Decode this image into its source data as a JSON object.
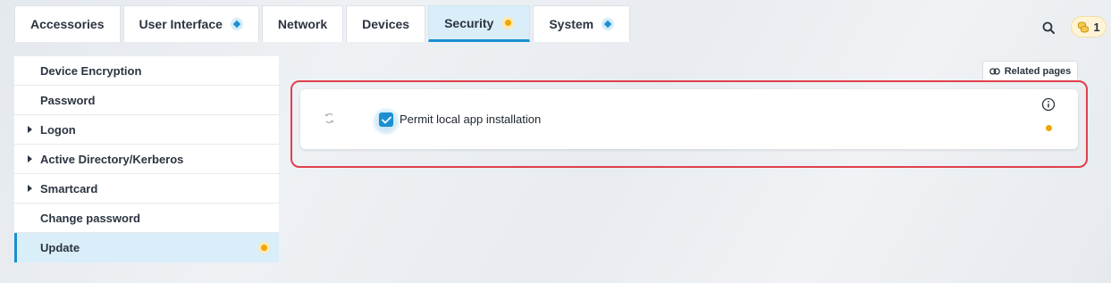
{
  "tabs": [
    {
      "label": "Accessories",
      "badge": null,
      "active": false
    },
    {
      "label": "User Interface",
      "badge": "diamond",
      "active": false
    },
    {
      "label": "Network",
      "badge": null,
      "active": false
    },
    {
      "label": "Devices",
      "badge": null,
      "active": false
    },
    {
      "label": "Security",
      "badge": "dot",
      "active": true
    },
    {
      "label": "System",
      "badge": "diamond",
      "active": false
    }
  ],
  "header": {
    "search_icon": "search-icon",
    "notification_count": "1",
    "notification_icon": "coins-icon"
  },
  "sidebar": {
    "items": [
      {
        "label": "Device Encryption",
        "expandable": false,
        "active": false
      },
      {
        "label": "Password",
        "expandable": false,
        "active": false
      },
      {
        "label": "Logon",
        "expandable": true,
        "active": false
      },
      {
        "label": "Active Directory/Kerberos",
        "expandable": true,
        "active": false
      },
      {
        "label": "Smartcard",
        "expandable": true,
        "active": false
      },
      {
        "label": "Change password",
        "expandable": false,
        "active": false
      },
      {
        "label": "Update",
        "expandable": false,
        "active": true,
        "badge": "dot"
      }
    ]
  },
  "related_pages": {
    "label": "Related pages",
    "icon": "link-icon"
  },
  "setting": {
    "label": "Permit local app installation",
    "checked": true,
    "reset_icon": "reset-icon",
    "info_icon": "info-icon",
    "status": "modified-dot"
  },
  "colors": {
    "accent": "#1b8fd0",
    "active_bg": "#d9eef9",
    "warning": "#f0a500",
    "highlight": "#e0404b"
  }
}
